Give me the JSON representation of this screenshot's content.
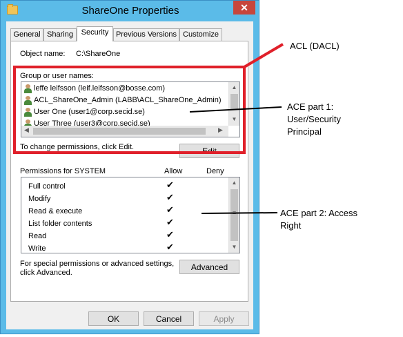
{
  "window": {
    "title": "ShareOne Properties",
    "close_glyph": "✕"
  },
  "tabs": [
    "General",
    "Sharing",
    "Security",
    "Previous Versions",
    "Customize"
  ],
  "object_name": {
    "label": "Object name:",
    "value": "C:\\ShareOne"
  },
  "group": {
    "label": "Group or user names:",
    "users": [
      "leffe leifsson (leif.leifsson@bosse.com)",
      "ACL_ShareOne_Admin (LABB\\ACL_ShareOne_Admin)",
      "User One (user1@corp.secid.se)",
      "User Three (user3@corp.secid.se)"
    ],
    "hint": "To change permissions, click Edit.",
    "edit_label": "Edit"
  },
  "permissions": {
    "header": "Permissions for SYSTEM",
    "allow_label": "Allow",
    "deny_label": "Deny",
    "rows": [
      "Full control",
      "Modify",
      "Read & execute",
      "List folder contents",
      "Read",
      "Write"
    ],
    "allow_glyph": "✔"
  },
  "advanced": {
    "text_line1": "For special permissions or advanced settings,",
    "text_line2": "click Advanced.",
    "button": "Advanced"
  },
  "footer": {
    "ok": "OK",
    "cancel": "Cancel",
    "apply": "Apply"
  },
  "annotations": {
    "acl": "ACL (DACL)",
    "ace1_line1": "ACE part 1:",
    "ace1_line2": "User/Security",
    "ace1_line3": "Principal",
    "ace2_line1": "ACE part 2: Access",
    "ace2_line2": "Right"
  },
  "colors": {
    "highlight_box": "#e0202a",
    "titlebar": "#5bbbe8"
  }
}
